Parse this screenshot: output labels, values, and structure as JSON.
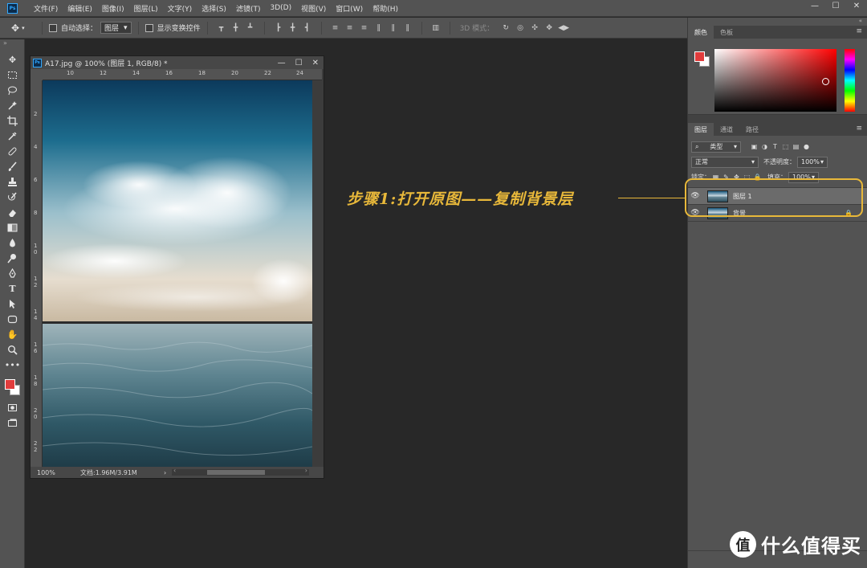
{
  "menu": {
    "logo": "Ps",
    "items": [
      "文件(F)",
      "编辑(E)",
      "图像(I)",
      "图层(L)",
      "文字(Y)",
      "选择(S)",
      "滤镜(T)",
      "3D(D)",
      "视图(V)",
      "窗口(W)",
      "帮助(H)"
    ]
  },
  "options": {
    "auto_select_label": "自动选择：",
    "auto_select_target": "图层",
    "show_transform_label": "显示变换控件",
    "mode3d_label": "3D 模式："
  },
  "document": {
    "title": "A17.jpg @ 100% (图层 1, RGB/8) *",
    "ruler_h": [
      "10",
      "12",
      "14",
      "16",
      "18",
      "20",
      "22",
      "24"
    ],
    "ruler_v": [
      "2",
      "4",
      "6",
      "8",
      "1 0",
      "1 2",
      "1 4",
      "1 6",
      "1 8",
      "2 0",
      "2 2"
    ],
    "zoom": "100%",
    "doc_info": "文档:1.96M/3.91M"
  },
  "annotation": {
    "text": "步骤1:打开原图——复制背景层",
    "color": "#e8b83a"
  },
  "color_panel": {
    "tabs": [
      "颜色",
      "色板"
    ],
    "foreground": "#e13c3c",
    "background": "#ffffff"
  },
  "layers_panel": {
    "tabs": [
      "图层",
      "通道",
      "路径"
    ],
    "filter_kind": "类型",
    "blend_mode": "正常",
    "opacity_label": "不透明度：",
    "opacity": "100%",
    "lock_label": "锁定：",
    "fill_label": "填充：",
    "fill": "100%",
    "layers": [
      {
        "name": "图层 1",
        "selected": true,
        "locked": false
      },
      {
        "name": "背景",
        "selected": false,
        "locked": true
      }
    ]
  },
  "watermark": {
    "logo": "值",
    "text": "什么值得买"
  }
}
